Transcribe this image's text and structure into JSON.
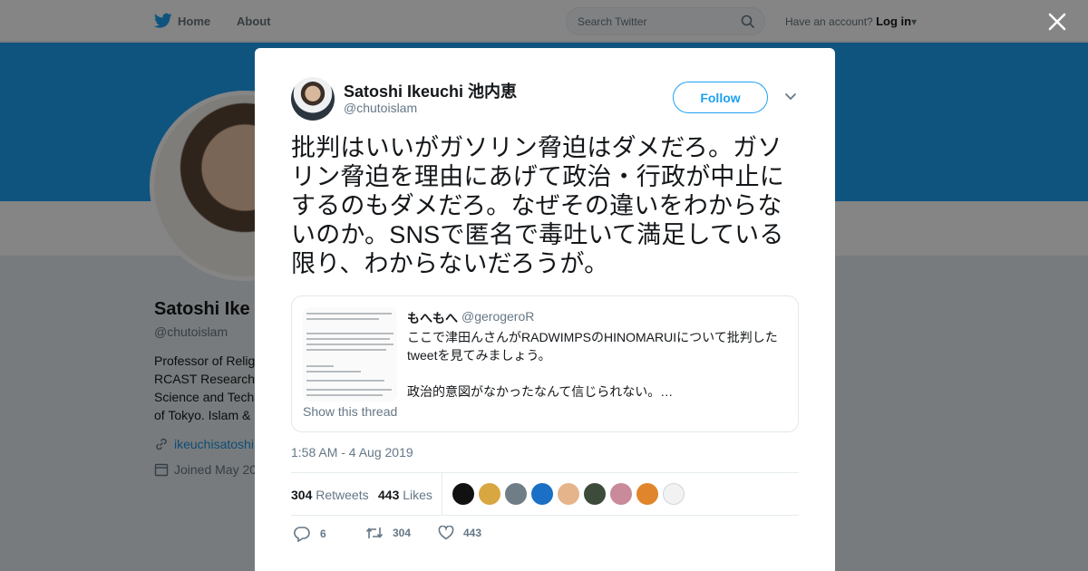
{
  "topbar": {
    "home_label": "Home",
    "about_label": "About",
    "search_placeholder": "Search Twitter",
    "account_prompt": "Have an account?",
    "login_label": "Log in"
  },
  "profile": {
    "name": "Satoshi Ike",
    "handle": "@chutoislam",
    "bio": [
      "Professor of Relig",
      "RCAST Research",
      "Science and Tech",
      "of Tokyo. Islam &"
    ],
    "link": "ikeuchisatoshi",
    "joined": "Joined May 20"
  },
  "tweet": {
    "author_name": "Satoshi Ikeuchi 池内恵",
    "author_handle": "@chutoislam",
    "follow_label": "Follow",
    "text": "批判はいいがガソリン脅迫はダメだろ。ガソリン脅迫を理由にあげて政治・行政が中止にするのもダメだろ。なぜその違いをわからないのか。SNSで匿名で毒吐いて満足している限り、わからないだろうが。",
    "timestamp": "1:58 AM - 4 Aug 2019",
    "retweets_count": "304",
    "retweets_label": "Retweets",
    "likes_count": "443",
    "likes_label": "Likes",
    "reply_count": "6",
    "retweet_action_count": "304",
    "like_action_count": "443"
  },
  "quoted": {
    "name": "もへもへ",
    "handle": "@gerogeroR",
    "text": "ここで津田んさんがRADWIMPSのHINOMARUIについて批判したtweetを見てみましょう。\n\n政治的意図がなかったなんて信じられない。…",
    "thread_label": "Show this thread"
  },
  "likers": [
    {
      "color": "#111111"
    },
    {
      "color": "#d9a741"
    },
    {
      "color": "#6f7d86"
    },
    {
      "color": "#1b6fc4"
    },
    {
      "color": "#e6b48a"
    },
    {
      "color": "#3d4b3a"
    },
    {
      "color": "#c98a9a"
    },
    {
      "color": "#e0852b"
    },
    {
      "color": "#f2f2f2"
    }
  ],
  "colors": {
    "accent": "#1da1f2",
    "text": "#14171a",
    "muted": "#657786"
  },
  "icons": [
    "twitter-bird-icon",
    "search-icon",
    "close-icon",
    "chevron-down-icon",
    "link-icon",
    "calendar-icon",
    "reply-icon",
    "retweet-icon",
    "heart-icon"
  ]
}
